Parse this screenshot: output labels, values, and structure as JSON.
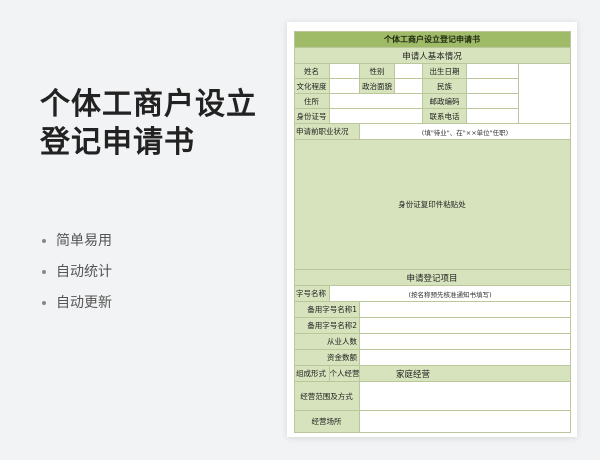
{
  "headline": {
    "line1": "个体工商户设立",
    "line2": "登记申请书"
  },
  "features": [
    "简单易用",
    "自动统计",
    "自动更新"
  ],
  "form": {
    "title": "个体工商户设立登记申请书",
    "section_basic": "申请人基本情况",
    "name": "姓名",
    "gender": "性别",
    "birth_date": "出生日期",
    "education": "文化程度",
    "political": "政治面貌",
    "ethnicity": "民族",
    "address": "住所",
    "postal_code": "邮政编码",
    "id_number": "身份证号",
    "phone": "联系电话",
    "prior_status": "申请前职业状况",
    "prior_status_hint": "(填\"待业\"、在\"××单位\"任职)",
    "id_copy_area": "身份证复印件粘贴处",
    "section_register": "申请登记项目",
    "trade_name": "字号名称",
    "trade_name_hint": "(按名称预先核准通知书填写)",
    "alt_name_1": "备用字号名称1",
    "alt_name_2": "备用字号名称2",
    "employees": "从业人数",
    "capital": "资金数额",
    "org_form": "组成形式",
    "org_individual": "个人经营",
    "org_family": "家庭经营",
    "business_scope": "经营范围及方式",
    "business_place": "经营场所"
  },
  "colors": {
    "header_green": "#9fbb68",
    "label_green": "#d7e3bc",
    "border": "#b9c79b"
  }
}
